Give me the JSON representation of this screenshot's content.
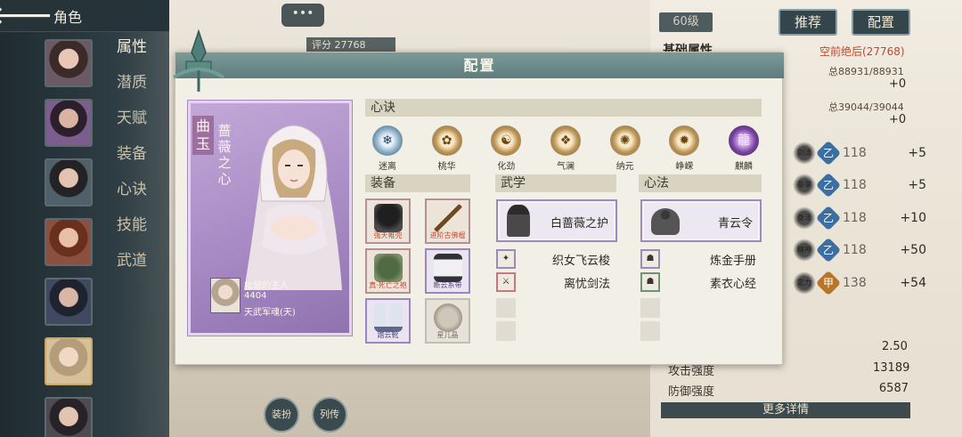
{
  "topbar": {
    "back_glyph": "🡐",
    "title": "角色"
  },
  "nav": [
    "属性",
    "潜质",
    "天赋",
    "装备",
    "心诀",
    "技能",
    "武道"
  ],
  "avatars": [
    "a1",
    "a2",
    "a3",
    "a4",
    "a5",
    "a6",
    "a7"
  ],
  "chat_bubble": "•••",
  "score_tag": "评分 27768",
  "level_badge": "60级",
  "buttons": {
    "recommend": "推荐",
    "config": "配置"
  },
  "stats": {
    "title": "基础属性",
    "rank": "空前绝后(27768)",
    "hp": "总88931/88931",
    "hp_plus": "+0",
    "mp": "总39044/39044",
    "mp_plus": "+0",
    "skills": [
      {
        "ink": "剑法",
        "badge": "乙",
        "badge_color": "#3b6ea3",
        "value": "118",
        "plus": "+5"
      },
      {
        "ink": "拳掌",
        "badge": "乙",
        "badge_color": "#3b6ea3",
        "value": "118",
        "plus": "+5"
      },
      {
        "ink": "身法",
        "badge": "乙",
        "badge_color": "#3b6ea3",
        "value": "118",
        "plus": "+10"
      },
      {
        "ink": "精神",
        "badge": "乙",
        "badge_color": "#3b6ea3",
        "value": "118",
        "plus": "+50"
      },
      {
        "ink": "定力",
        "badge": "甲",
        "badge_color": "#b8752a",
        "value": "138",
        "plus": "+54"
      }
    ],
    "val_250": "2.50",
    "attack_label": "攻击强度",
    "attack_value": "13189",
    "defense_label": "防御强度",
    "defense_value": "6587",
    "more": "更多详情"
  },
  "bottom_buttons": {
    "costume": "装扮",
    "biography": "列传"
  },
  "modal": {
    "title": "配置",
    "character": {
      "surname": "曲玉",
      "title": "蔷薇之心",
      "owner_name": "松鼠的主人",
      "owner_id": "4404",
      "owner_realm": "天武军魂(天)"
    },
    "sections": {
      "xinjue": "心诀",
      "zhuangbei": "装备",
      "wuxue": "武学",
      "xinfa": "心法"
    },
    "xinjue_items": [
      {
        "label": "迷离",
        "glyph": "❄",
        "tone": "blue"
      },
      {
        "label": "桃华",
        "glyph": "✿",
        "tone": "gold"
      },
      {
        "label": "化劲",
        "glyph": "☯",
        "tone": "gold"
      },
      {
        "label": "气澜",
        "glyph": "❖",
        "tone": "gold"
      },
      {
        "label": "纳元",
        "glyph": "✺",
        "tone": "gold"
      },
      {
        "label": "峥嵘",
        "glyph": "✹",
        "tone": "gold"
      },
      {
        "label": "麒麟",
        "glyph": "龍",
        "tone": "purple"
      }
    ],
    "equipment": [
      {
        "label": "强天帷兜",
        "tone": "red",
        "art": "#2f2f30"
      },
      {
        "label": "进阶古佛棍",
        "tone": "red",
        "art": "#6b5030"
      },
      {
        "label": "真·死亡之袍",
        "tone": "red",
        "art": "#4f6b44"
      },
      {
        "label": "断云系带",
        "tone": "purple",
        "art": "#e7e5e8"
      },
      {
        "label": "踏云靴",
        "tone": "purple",
        "art": "#5d6a8a"
      },
      {
        "label": "星儿晶",
        "tone": "gray",
        "art": "#b8b0a2"
      }
    ],
    "wuxue_main": "白蔷薇之护",
    "wuxue_subs": [
      {
        "label": "织女飞云梭",
        "glyph": "✦",
        "tone": "purple"
      },
      {
        "label": "离忧剑法",
        "glyph": "⚔",
        "tone": "red"
      }
    ],
    "xinfa_main": "青云令",
    "xinfa_subs": [
      {
        "label": "炼金手册",
        "glyph": "☗",
        "tone": "purple"
      },
      {
        "label": "素衣心经",
        "glyph": "☗",
        "tone": "green"
      }
    ]
  }
}
